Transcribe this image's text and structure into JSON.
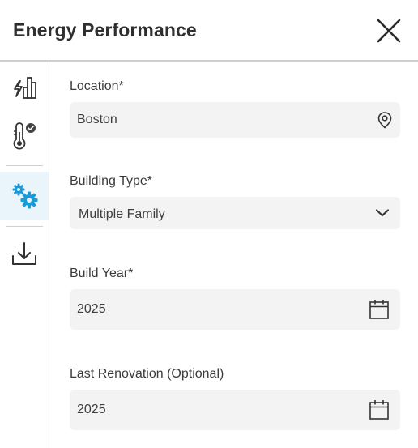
{
  "panel": {
    "title": "Energy Performance",
    "close_icon": "close-icon"
  },
  "sidebar": {
    "items": [
      {
        "name": "energy-chart-icon",
        "active": false
      },
      {
        "name": "thermometer-check-icon",
        "active": false
      },
      {
        "name": "gears-icon",
        "active": true
      },
      {
        "name": "download-icon",
        "active": false
      }
    ],
    "accent": "#1a9ad6"
  },
  "form": {
    "location": {
      "label": "Location*",
      "value": "Boston",
      "icon": "location-pin-icon"
    },
    "building_type": {
      "label": "Building Type*",
      "value": "Multiple Family",
      "icon": "chevron-down-icon"
    },
    "build_year": {
      "label": "Build Year*",
      "value": "2025",
      "icon": "calendar-icon"
    },
    "last_renovation": {
      "label": "Last Renovation (Optional)",
      "value": "2025",
      "icon": "calendar-icon"
    }
  }
}
